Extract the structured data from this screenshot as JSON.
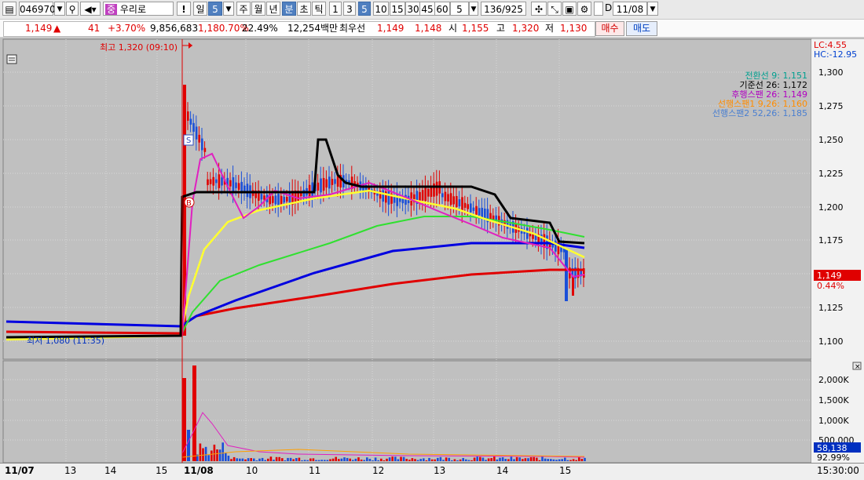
{
  "toolbar": {
    "code": "046970",
    "stock_badge": "중",
    "stock_name": "우리로",
    "warn": "!",
    "period_day": "일",
    "period_day_num": "5",
    "period_week": "주",
    "period_month": "월",
    "period_year": "년",
    "period_min": "분",
    "period_sec": "초",
    "period_tick": "틱",
    "intervals": [
      "1",
      "3",
      "5",
      "10",
      "15",
      "30",
      "45",
      "60"
    ],
    "interval_active": "5",
    "interval_select": "5",
    "count": "136",
    "count_total": "/925",
    "d_label": "D",
    "date": "11/08"
  },
  "quote": {
    "price": "1,149",
    "arrow": "▲",
    "change": "41",
    "change_pct": "+3.70%",
    "volume": "9,856,683",
    "vol_ratio": "1,180.70%",
    "turnover": "22.49%",
    "amount": "12,254백만",
    "best_label": "최우선",
    "best_ask": "1,149",
    "best_bid": "1,148",
    "open_label": "시",
    "open": "1,155",
    "high_label": "고",
    "high": "1,320",
    "low_label": "저",
    "low": "1,130",
    "buy_btn": "매수",
    "sell_btn": "매도"
  },
  "chart": {
    "lc": "LC:4.55",
    "hc": "HC:-12.95",
    "high_marker": "최고 1,320 (09:10)",
    "low_marker": "최저 1,080 (11:35)",
    "price_axis": [
      "1,300",
      "1,275",
      "1,250",
      "1,225",
      "1,200",
      "1,175",
      "1,125",
      "1,100"
    ],
    "current_price": "1,149",
    "current_pct": "0.44%",
    "volume_axis": [
      "2,000K",
      "1,500K",
      "1,000K",
      "500,000"
    ],
    "current_volume": "58,138",
    "volume_pct": "92.99%",
    "signal_s": "S",
    "signal_b": "B",
    "legend": [
      {
        "text": "전환선 9: 1,151",
        "color": "#00a090"
      },
      {
        "text": "기준선 26: 1,172",
        "color": "#000000"
      },
      {
        "text": "후행스팬 26: 1,149",
        "color": "#b000c0"
      },
      {
        "text": "선행스팬1 9,26: 1,160",
        "color": "#ff8c00"
      },
      {
        "text": "선행스팬2 52,26: 1,185",
        "color": "#4a7fd0"
      }
    ],
    "colors": {
      "up": "#e00000",
      "down": "#1a4fd8",
      "ma5": "#e020c0",
      "ma10": "#ffff30",
      "ma20": "#30e030",
      "ma60": "#0000e0",
      "ma120": "#e00000",
      "base": "#000000"
    }
  },
  "x_axis": {
    "labels": [
      "11/07",
      "13",
      "14",
      "15",
      "11/08",
      "10",
      "11",
      "12",
      "13",
      "14",
      "15"
    ],
    "time": "15:30:00"
  }
}
